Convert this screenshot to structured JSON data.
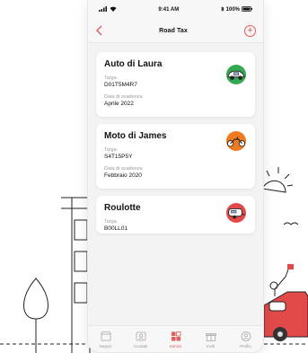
{
  "status": {
    "time": "9:41 AM",
    "battery": "100%"
  },
  "nav": {
    "title": "Road Tax"
  },
  "vehicles": [
    {
      "name": "Auto di Laura",
      "plate_label": "Targa",
      "plate": "D01T5M4R7",
      "expiry_label": "Data di scadenza",
      "expiry": "Aprile 2022",
      "icon": "car-icon",
      "color": "#34a853"
    },
    {
      "name": "Moto di James",
      "plate_label": "Targa",
      "plate": "S4T15P5Y",
      "expiry_label": "Data di scadenza",
      "expiry": "Febbraio 2020",
      "icon": "motorbike-icon",
      "color": "#f07a1f"
    },
    {
      "name": "Roulotte",
      "plate_label": "Targa",
      "plate": "B00LL01",
      "icon": "caravan-icon",
      "color": "#e24a4a"
    }
  ],
  "tabs": [
    {
      "label": "Negozi",
      "icon": "store-icon"
    },
    {
      "label": "Contatti",
      "icon": "contacts-icon"
    },
    {
      "label": "Servizi",
      "icon": "services-icon",
      "active": true
    },
    {
      "label": "Inviti",
      "icon": "gift-icon"
    },
    {
      "label": "Profilo",
      "icon": "profile-icon"
    }
  ],
  "colors": {
    "accent": "#e05b5b"
  }
}
